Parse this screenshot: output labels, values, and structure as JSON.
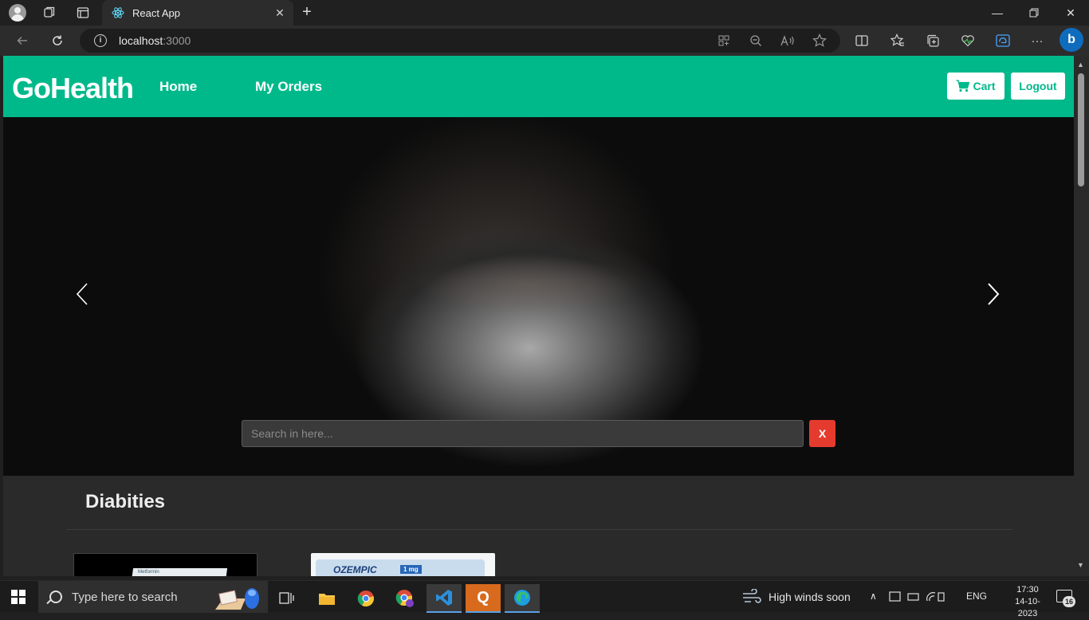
{
  "browser": {
    "tab_title": "React App",
    "url_prefix": "localhost",
    "url_port": ":3000",
    "icons": [
      "profile-icon",
      "workspaces-icon",
      "tab-actions-icon",
      "react-favicon",
      "close-tab-icon",
      "new-tab-icon",
      "back-icon",
      "refresh-icon",
      "site-info-icon",
      "app-available-icon",
      "zoom-out-icon",
      "read-aloud-icon",
      "favorite-star-icon",
      "split-screen-icon",
      "favorites-icon",
      "collections-icon",
      "browser-essentials-icon",
      "edge-bar-icon",
      "more-icon",
      "bing-chat-icon"
    ]
  },
  "app": {
    "brand": "GoHealth",
    "nav": {
      "home": "Home",
      "orders": "My Orders"
    },
    "cart_label": "Cart",
    "logout_label": "Logout",
    "search": {
      "placeholder": "Search in here..."
    },
    "clear_label": "X",
    "section_title": "Diabities",
    "product_cards": [
      {
        "label": "Metformin"
      },
      {
        "label": "OZEMPIC",
        "dose": "1 mg"
      }
    ],
    "colors": {
      "brand": "#00b98b",
      "clear_button": "#e53b2f",
      "page_bg": "#2a2a2a"
    }
  },
  "taskbar": {
    "search_placeholder": "Type here to search",
    "weather": "High winds soon",
    "language": "ENG",
    "time": "17:30",
    "date": "14-10-2023",
    "notification_count": "16"
  }
}
